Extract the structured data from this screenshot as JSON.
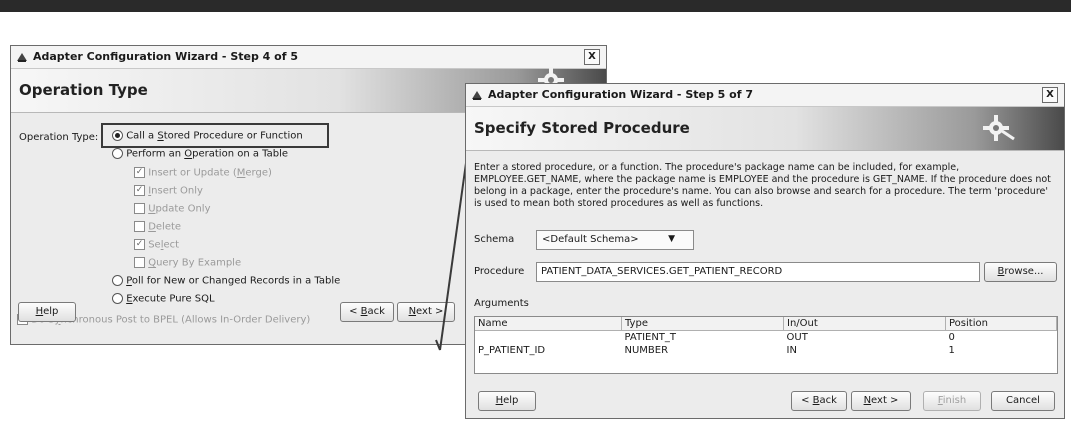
{
  "wizard1": {
    "title": "Adapter Configuration Wizard - Step 4 of 5",
    "close_label": "X",
    "header": "Operation Type",
    "operation_label": "Operation Type:",
    "options": {
      "call_stored": {
        "pre": "Call a ",
        "u": "S",
        "post": "tored Procedure or Function",
        "selected": true
      },
      "perform_op": {
        "pre": "Perform an ",
        "u": "O",
        "post": "peration on a Table",
        "selected": false
      },
      "poll": {
        "pre": "",
        "u": "P",
        "post": "oll for New or Changed Records in a Table",
        "selected": false
      },
      "execute_sql": {
        "pre": "",
        "u": "E",
        "post": "xecute Pure SQL",
        "selected": false
      }
    },
    "table_ops": [
      {
        "pre": "Insert or Update (",
        "u": "M",
        "post": "erge)",
        "checked": true
      },
      {
        "pre": "",
        "u": "I",
        "post": "nsert Only",
        "checked": true
      },
      {
        "pre": "",
        "u": "U",
        "post": "pdate Only",
        "checked": false
      },
      {
        "pre": "",
        "u": "D",
        "post": "elete",
        "checked": false
      },
      {
        "pre": "Se",
        "u": "l",
        "post": "ect",
        "checked": true
      },
      {
        "pre": "",
        "u": "Q",
        "post": "uery By Example",
        "checked": false
      }
    ],
    "sync_post": {
      "pre": "Do S",
      "u": "y",
      "post": "nchronous Post to BPEL (Allows In-Order Delivery)",
      "checked": false
    },
    "buttons": {
      "help": {
        "u": "H",
        "post": "elp"
      },
      "back": {
        "pre": "< ",
        "u": "B",
        "post": "ack"
      },
      "next": {
        "u": "N",
        "post": "ext >"
      }
    }
  },
  "wizard2": {
    "title": "Adapter Configuration Wizard - Step 5 of 7",
    "close_label": "X",
    "header": "Specify Stored Procedure",
    "description": "Enter a stored procedure, or a function. The procedure's package name can be included, for example, EMPLOYEE.GET_NAME, where the package name is EMPLOYEE and the procedure is GET_NAME.  If the procedure does not belong in a package, enter the procedure's name. You can also browse and search for a procedure. The term 'procedure' is used to mean both stored procedures as well as functions.",
    "schema_label": "Schema",
    "schema_value": "<Default Schema>",
    "procedure_label": "Procedure",
    "procedure_value": "PATIENT_DATA_SERVICES.GET_PATIENT_RECORD",
    "browse": {
      "u": "B",
      "post": "rowse..."
    },
    "arguments_label": "Arguments",
    "columns": [
      "Name",
      "Type",
      "In/Out",
      "Position"
    ],
    "rows": [
      [
        "",
        "PATIENT_T",
        "OUT",
        "0"
      ],
      [
        "P_PATIENT_ID",
        "NUMBER",
        "IN",
        "1"
      ]
    ],
    "buttons": {
      "help": {
        "u": "H",
        "post": "elp"
      },
      "back": {
        "pre": "< ",
        "u": "B",
        "post": "ack"
      },
      "next": {
        "u": "N",
        "post": "ext >"
      },
      "finish": {
        "u": "F",
        "post": "inish"
      },
      "cancel": "Cancel"
    }
  },
  "colors": {
    "highlight_box": "#3a3a3a",
    "banner_dark": "#4a4a4a",
    "dialog_bg": "#ececec"
  }
}
